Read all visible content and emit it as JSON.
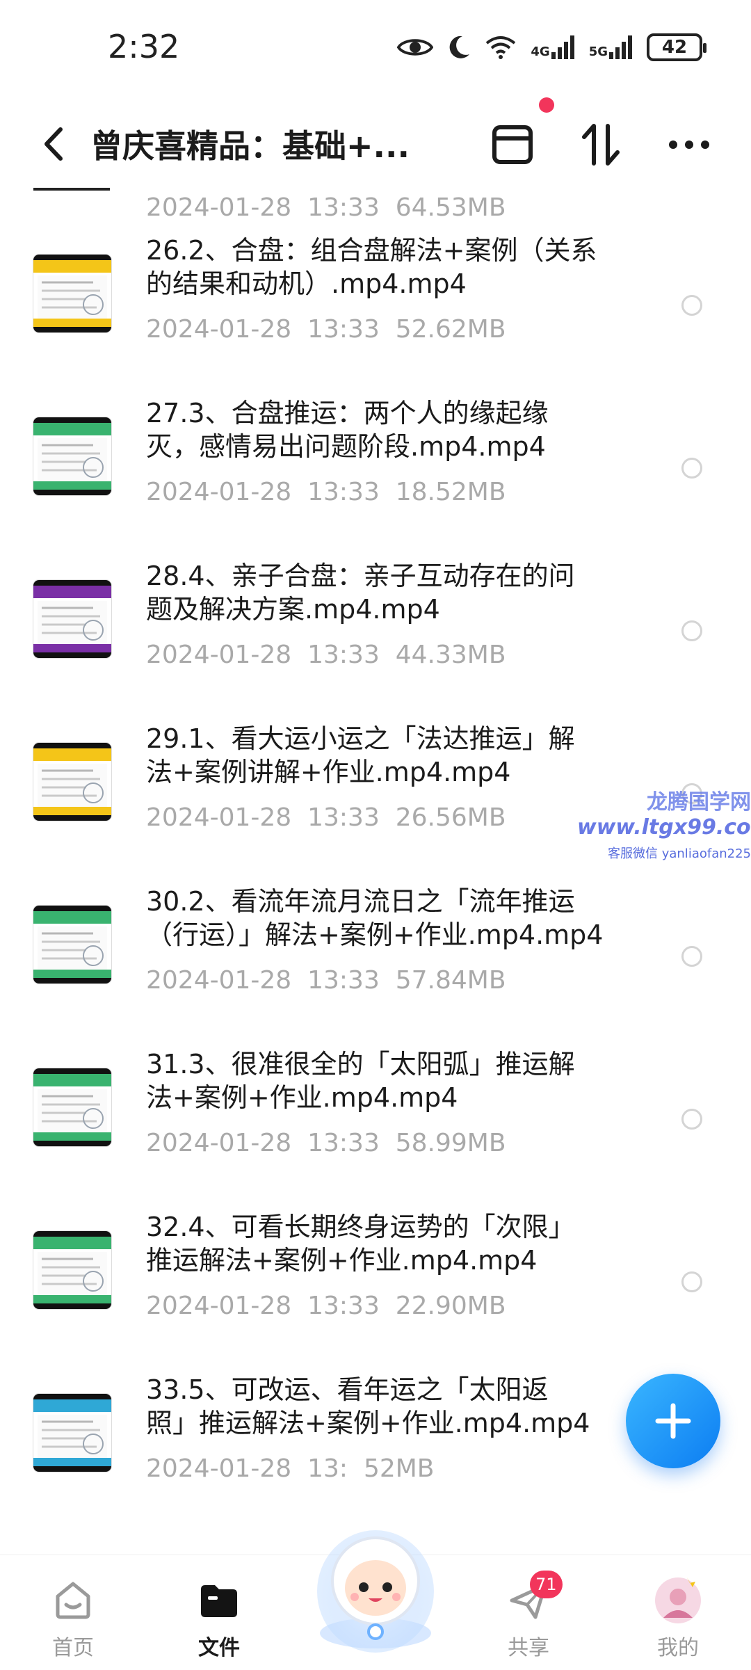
{
  "status_bar": {
    "time": "2:32",
    "network_1": "4G",
    "network_2": "5G",
    "battery": "42"
  },
  "header": {
    "title": "曾庆喜精品：基础+..."
  },
  "partial_item": {
    "date": "2024-01-28",
    "time": "13:33",
    "size": "64.53MB"
  },
  "items": [
    {
      "name": "26.2、合盘：组合盘解法+案例（关系\n的结果和动机）.mp4.mp4",
      "date": "2024-01-28",
      "time": "13:33",
      "size": "52.62MB",
      "thumb_color": "#f4c518"
    },
    {
      "name": "27.3、合盘推运：两个人的缘起缘\n灭，感情易出问题阶段.mp4.mp4",
      "date": "2024-01-28",
      "time": "13:33",
      "size": "18.52MB",
      "thumb_color": "#39b36f"
    },
    {
      "name": "28.4、亲子合盘：亲子互动存在的问\n题及解决方案.mp4.mp4",
      "date": "2024-01-28",
      "time": "13:33",
      "size": "44.33MB",
      "thumb_color": "#7a2fa6"
    },
    {
      "name": "29.1、看大运小运之「法达推运」解\n法+案例讲解+作业.mp4.mp4",
      "date": "2024-01-28",
      "time": "13:33",
      "size": "26.56MB",
      "thumb_color": "#f4c518"
    },
    {
      "name": "30.2、看流年流月流日之「流年推运\n（行运）」解法+案例+作业.mp4.mp4",
      "date": "2024-01-28",
      "time": "13:33",
      "size": "57.84MB",
      "thumb_color": "#39b36f"
    },
    {
      "name": "31.3、很准很全的「太阳弧」推运解\n法+案例+作业.mp4.mp4",
      "date": "2024-01-28",
      "time": "13:33",
      "size": "58.99MB",
      "thumb_color": "#39b36f"
    },
    {
      "name": "32.4、可看长期终身运势的「次限」\n推运解法+案例+作业.mp4.mp4",
      "date": "2024-01-28",
      "time": "13:33",
      "size": "22.90MB",
      "thumb_color": "#39b36f"
    },
    {
      "name": "33.5、可改运、看年运之「太阳返\n照」推运解法+案例+作业.mp4.mp4",
      "date": "2024-01-28",
      "time": "13:",
      "size": "52MB",
      "thumb_color": "#2fa8d6"
    }
  ],
  "watermark": {
    "line1": "龙腾国学网",
    "line2": "www.ltgx99.com",
    "line3": "客服微信 yanliaofan225"
  },
  "nav": {
    "home": "首页",
    "files": "文件",
    "share": "共享",
    "share_badge": "71",
    "mine": "我的"
  },
  "colors": {
    "accent": "#0c7df2",
    "badge": "#f2355b",
    "meta_text": "#a9a9a9"
  }
}
